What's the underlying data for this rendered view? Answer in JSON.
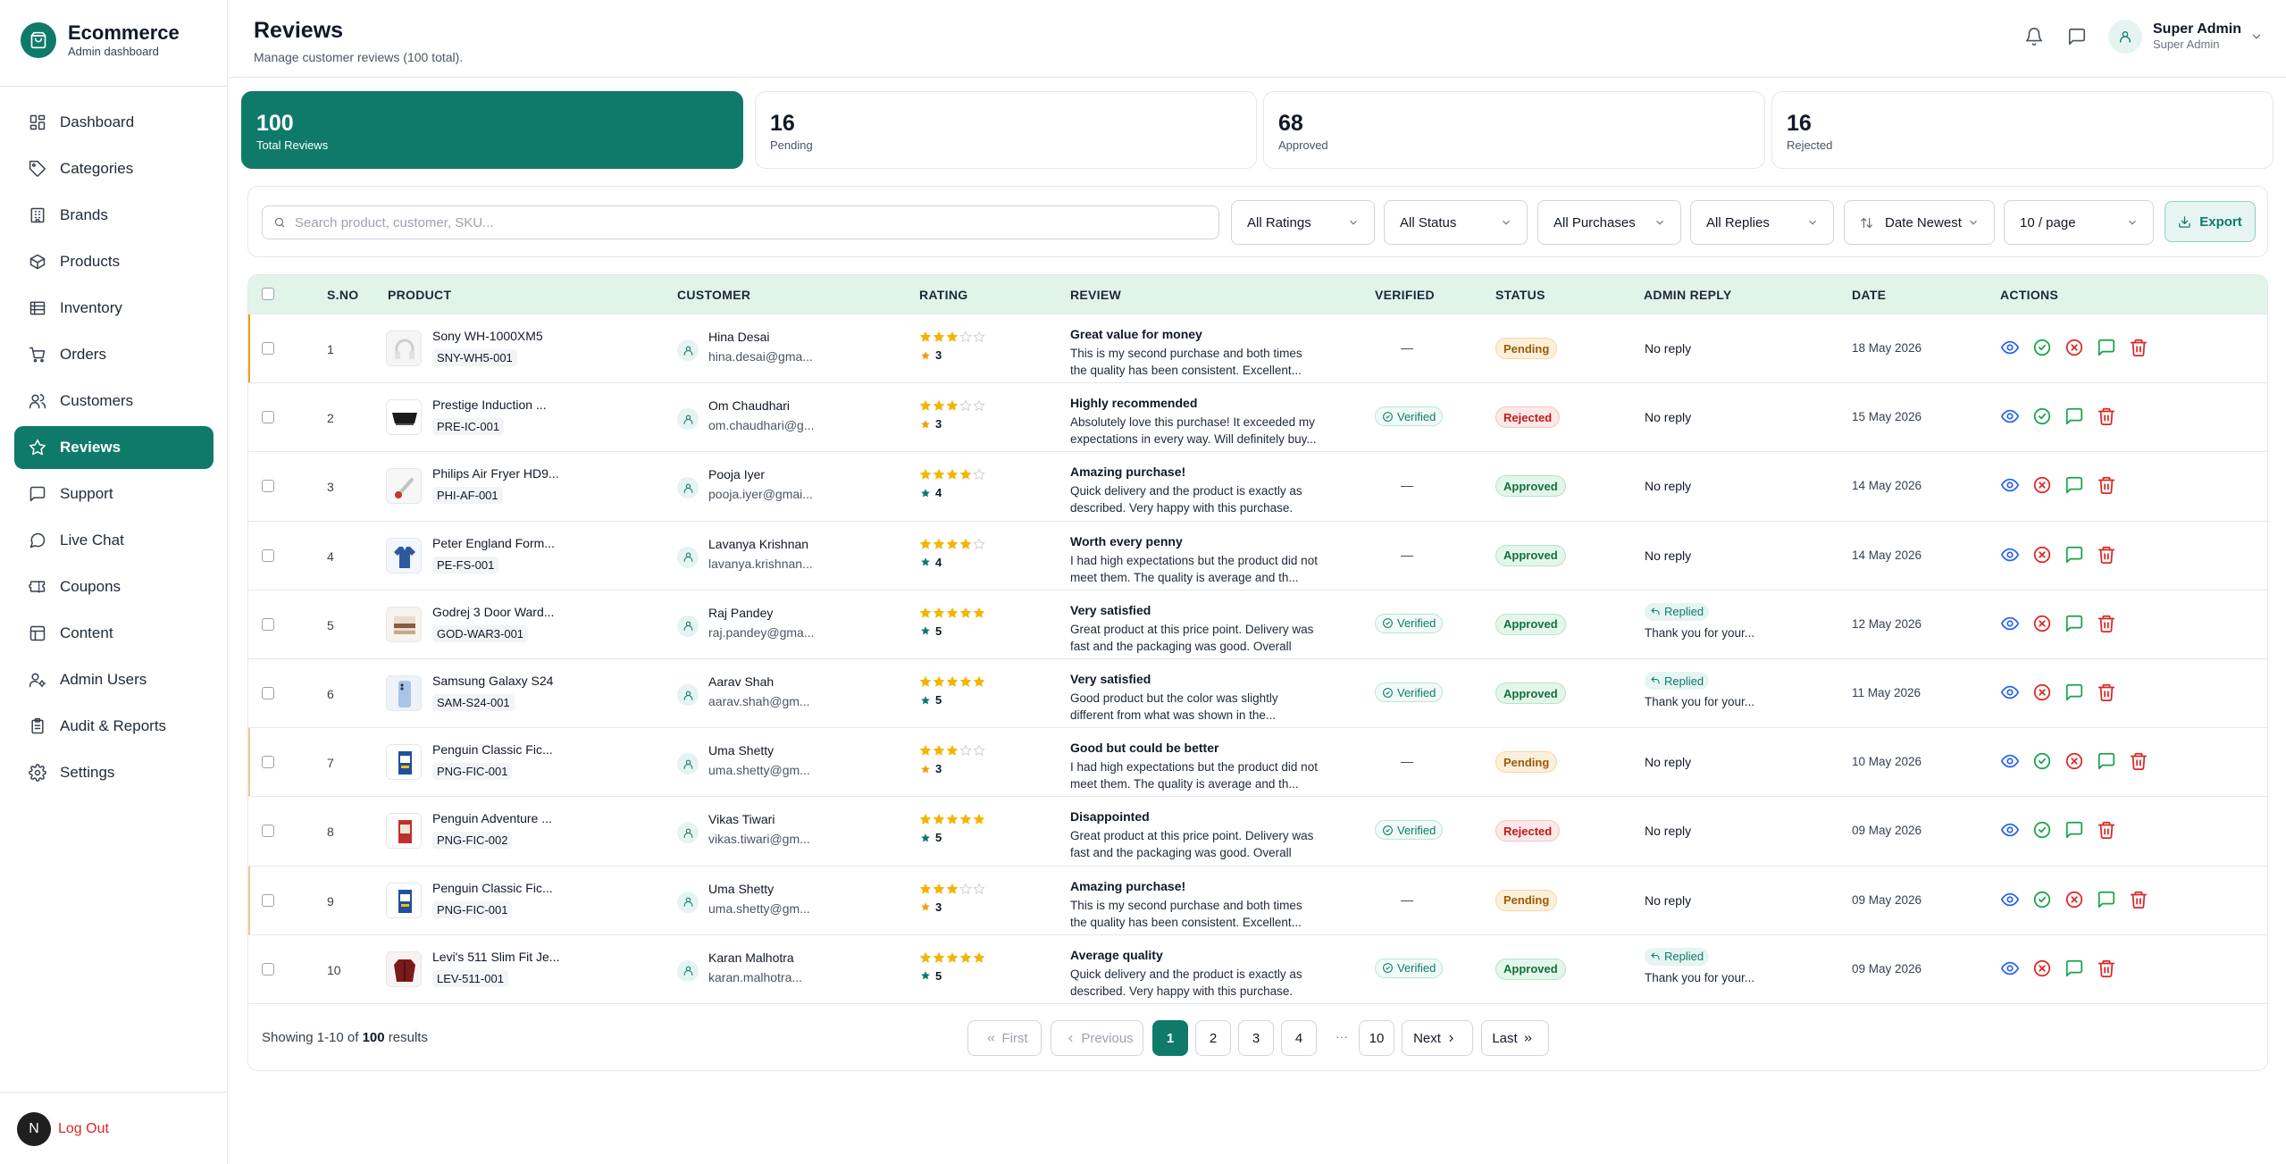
{
  "brand": {
    "name": "Ecommerce",
    "subtitle": "Admin dashboard"
  },
  "nav": [
    {
      "label": "Dashboard",
      "icon": "dashboard-icon"
    },
    {
      "label": "Categories",
      "icon": "tag-icon"
    },
    {
      "label": "Brands",
      "icon": "building-icon"
    },
    {
      "label": "Products",
      "icon": "box-icon"
    },
    {
      "label": "Inventory",
      "icon": "inventory-icon"
    },
    {
      "label": "Orders",
      "icon": "cart-icon"
    },
    {
      "label": "Customers",
      "icon": "users-icon"
    },
    {
      "label": "Reviews",
      "icon": "star-icon",
      "active": true
    },
    {
      "label": "Support",
      "icon": "message-square-icon"
    },
    {
      "label": "Live Chat",
      "icon": "chat-bubble-icon"
    },
    {
      "label": "Coupons",
      "icon": "ticket-icon"
    },
    {
      "label": "Content",
      "icon": "layout-icon"
    },
    {
      "label": "Admin Users",
      "icon": "user-cog-icon"
    },
    {
      "label": "Audit & Reports",
      "icon": "clipboard-icon"
    },
    {
      "label": "Settings",
      "icon": "gear-icon"
    }
  ],
  "logout": {
    "avatar": "N",
    "label": "Log Out"
  },
  "header": {
    "title": "Reviews",
    "subtitle": "Manage customer reviews (100 total).",
    "user": {
      "name": "Super Admin",
      "role": "Super Admin"
    }
  },
  "stats": [
    {
      "value": "100",
      "label": "Total Reviews"
    },
    {
      "value": "16",
      "label": "Pending"
    },
    {
      "value": "68",
      "label": "Approved"
    },
    {
      "value": "16",
      "label": "Rejected"
    }
  ],
  "filters": {
    "search_placeholder": "Search product, customer, SKU...",
    "ratings": "All Ratings",
    "status": "All Status",
    "purchases": "All Purchases",
    "replies": "All Replies",
    "sort": "Date Newest",
    "per_page": "10 / page",
    "export": "Export"
  },
  "columns": [
    "S.NO",
    "PRODUCT",
    "CUSTOMER",
    "RATING",
    "REVIEW",
    "VERIFIED",
    "STATUS",
    "ADMIN REPLY",
    "DATE",
    "ACTIONS"
  ],
  "labels": {
    "verified": "Verified",
    "no_reply": "No reply",
    "replied": "Replied",
    "dash": "—"
  },
  "rows": [
    {
      "sno": "1",
      "product": "Sony WH-1000XM5",
      "sku": "SNY-WH5-001",
      "customer": "Hina Desai",
      "email": "hina.desai@gma...",
      "rating": 3,
      "title": "Great value for money",
      "body": "This is my second purchase and both times the quality has been consistent. Excellent...",
      "verified": false,
      "status": "Pending",
      "reply": "",
      "date": "18 May 2026",
      "thumb": "headphones"
    },
    {
      "sno": "2",
      "product": "Prestige Induction ...",
      "sku": "PRE-IC-001",
      "customer": "Om Chaudhari",
      "email": "om.chaudhari@g...",
      "rating": 3,
      "title": "Highly recommended",
      "body": "Absolutely love this purchase! It exceeded my expectations in every way. Will definitely buy...",
      "verified": true,
      "status": "Rejected",
      "reply": "",
      "date": "15 May 2026",
      "thumb": "cooktop"
    },
    {
      "sno": "3",
      "product": "Philips Air Fryer HD9...",
      "sku": "PHI-AF-001",
      "customer": "Pooja Iyer",
      "email": "pooja.iyer@gmai...",
      "rating": 4,
      "title": "Amazing purchase!",
      "body": "Quick delivery and the product is exactly as described. Very happy with this purchase. Fiv...",
      "verified": false,
      "status": "Approved",
      "reply": "",
      "date": "14 May 2026",
      "thumb": "fryer"
    },
    {
      "sno": "4",
      "product": "Peter England Form...",
      "sku": "PE-FS-001",
      "customer": "Lavanya Krishnan",
      "email": "lavanya.krishnan...",
      "rating": 4,
      "title": "Worth every penny",
      "body": "I had high expectations but the product did not meet them. The quality is average and th...",
      "verified": false,
      "status": "Approved",
      "reply": "",
      "date": "14 May 2026",
      "thumb": "shirt"
    },
    {
      "sno": "5",
      "product": "Godrej 3 Door Ward...",
      "sku": "GOD-WAR3-001",
      "customer": "Raj Pandey",
      "email": "raj.pandey@gma...",
      "rating": 5,
      "title": "Very satisfied",
      "body": "Great product at this price point. Delivery was fast and the packaging was good. Overall ver...",
      "verified": true,
      "status": "Approved",
      "reply": "Thank you for your...",
      "date": "12 May 2026",
      "thumb": "wardrobe"
    },
    {
      "sno": "6",
      "product": "Samsung Galaxy S24",
      "sku": "SAM-S24-001",
      "customer": "Aarav Shah",
      "email": "aarav.shah@gm...",
      "rating": 5,
      "title": "Very satisfied",
      "body": "Good product but the color was slightly different from what was shown in the...",
      "verified": true,
      "status": "Approved",
      "reply": "Thank you for your...",
      "date": "11 May 2026",
      "thumb": "phone"
    },
    {
      "sno": "7",
      "product": "Penguin Classic Fic...",
      "sku": "PNG-FIC-001",
      "customer": "Uma Shetty",
      "email": "uma.shetty@gm...",
      "rating": 3,
      "title": "Good but could be better",
      "body": "I had high expectations but the product did not meet them. The quality is average and th...",
      "verified": false,
      "status": "Pending",
      "reply": "",
      "date": "10 May 2026",
      "thumb": "book-blue"
    },
    {
      "sno": "8",
      "product": "Penguin Adventure ...",
      "sku": "PNG-FIC-002",
      "customer": "Vikas Tiwari",
      "email": "vikas.tiwari@gm...",
      "rating": 5,
      "title": "Disappointed",
      "body": "Great product at this price point. Delivery was fast and the packaging was good. Overall ver...",
      "verified": true,
      "status": "Rejected",
      "reply": "",
      "date": "09 May 2026",
      "thumb": "book-red"
    },
    {
      "sno": "9",
      "product": "Penguin Classic Fic...",
      "sku": "PNG-FIC-001",
      "customer": "Uma Shetty",
      "email": "uma.shetty@gm...",
      "rating": 3,
      "title": "Amazing purchase!",
      "body": "This is my second purchase and both times the quality has been consistent. Excellent...",
      "verified": false,
      "status": "Pending",
      "reply": "",
      "date": "09 May 2026",
      "thumb": "book-blue"
    },
    {
      "sno": "10",
      "product": "Levi's 511 Slim Fit Je...",
      "sku": "LEV-511-001",
      "customer": "Karan Malhotra",
      "email": "karan.malhotra...",
      "rating": 5,
      "title": "Average quality",
      "body": "Quick delivery and the product is exactly as described. Very happy with this purchase. Fiv...",
      "verified": true,
      "status": "Approved",
      "reply": "Thank you for your...",
      "date": "09 May 2026",
      "thumb": "jacket"
    }
  ],
  "footer": {
    "showing_prefix": "Showing 1-10 of ",
    "showing_total": "100",
    "showing_suffix": " results",
    "first": "First",
    "previous": "Previous",
    "pages": [
      "1",
      "2",
      "3",
      "4"
    ],
    "ellipsis": "···",
    "last_page": "10",
    "next": "Next",
    "last": "Last"
  },
  "colors": {
    "accent": "#0f7a6a",
    "star": "#f5b400",
    "danger": "#dc2626",
    "success": "#16a34a",
    "info": "#2563eb"
  }
}
